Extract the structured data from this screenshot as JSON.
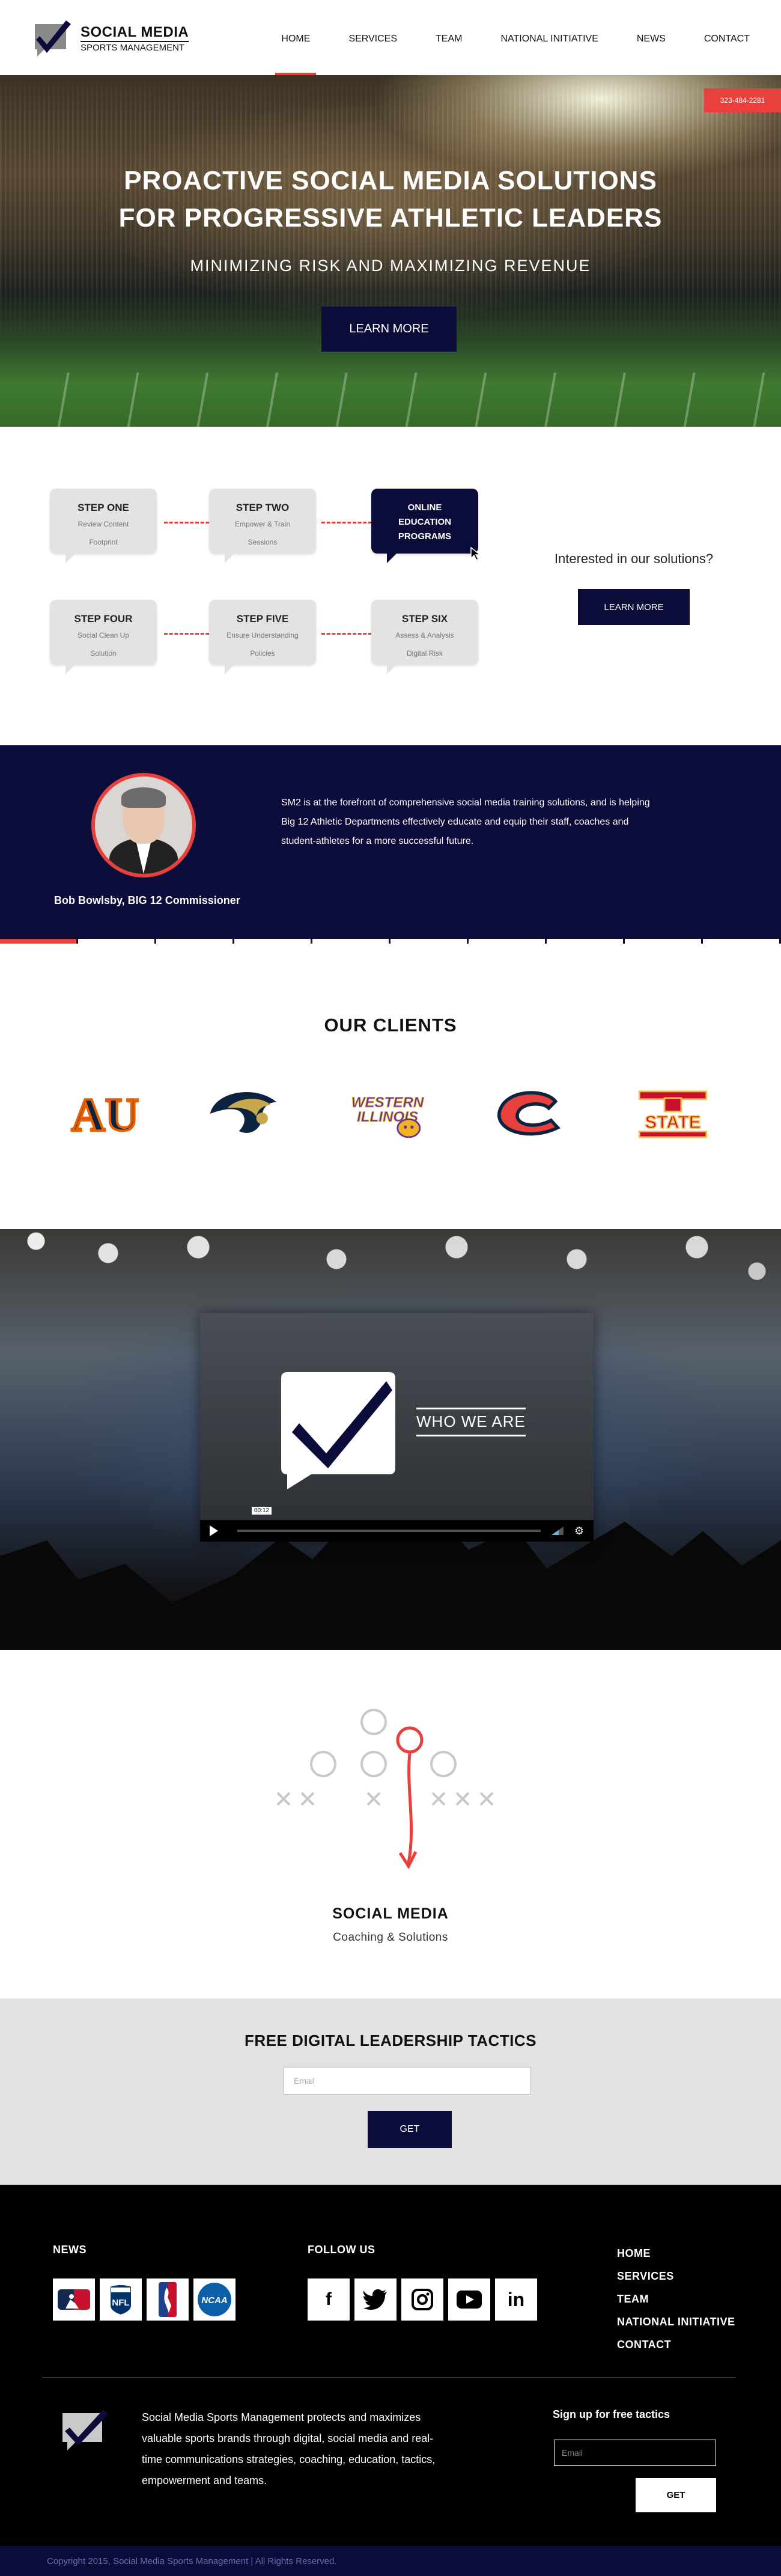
{
  "header": {
    "logo_line1": "SOCIAL MEDIA",
    "logo_line2": "SPORTS MANAGEMENT",
    "nav": [
      {
        "label": "HOME",
        "active": true
      },
      {
        "label": "SERVICES"
      },
      {
        "label": "TEAM"
      },
      {
        "label": "NATIONAL INITIATIVE"
      },
      {
        "label": "NEWS"
      },
      {
        "label": "CONTACT"
      }
    ]
  },
  "hero": {
    "phone": "323-484-2281",
    "title_line1": "PROACTIVE SOCIAL MEDIA SOLUTIONS",
    "title_line2": "FOR PROGRESSIVE ATHLETIC LEADERS",
    "subtitle": "MINIMIZING RISK AND MAXIMIZING REVENUE",
    "cta": "LEARN MORE"
  },
  "steps": {
    "items": [
      {
        "title": "STEP ONE",
        "desc_line1": "Review Content",
        "desc_line2": "Footprint"
      },
      {
        "title": "STEP TWO",
        "desc_line1": "Empower & Train",
        "desc_line2": "Sessions"
      },
      {
        "title_line1": "ONLINE",
        "title_line2": "EDUCATION",
        "title_line3": "PROGRAMS",
        "active": true
      },
      {
        "title": "STEP FOUR",
        "desc_line1": "Social Clean Up",
        "desc_line2": "Solution"
      },
      {
        "title": "STEP FIVE",
        "desc_line1": "Ensure Understanding",
        "desc_line2": "Policies"
      },
      {
        "title": "STEP SIX",
        "desc_line1": "Assess & Analysis",
        "desc_line2": "Digital Risk"
      }
    ],
    "interest": "Interested in our solutions?",
    "cta": "LEARN MORE"
  },
  "testimonial": {
    "name": "Bob Bowlsby, BIG 12 Commissioner",
    "quote": "SM2 is at the forefront of comprehensive social media training solutions, and is helping Big 12 Athletic Departments effectively educate and equip their staff, coaches and student-athletes for a more successful future.",
    "slides_total": 10,
    "slide_active": 1
  },
  "clients": {
    "heading": "OUR CLIENTS",
    "logos": [
      {
        "icon": "auburn-au-logo",
        "text": "AU"
      },
      {
        "icon": "rams-horn-logo"
      },
      {
        "icon": "western-illinois-logo",
        "text_line1": "WESTERN",
        "text_line2": "ILLINOIS"
      },
      {
        "icon": "chicago-bears-c-logo"
      },
      {
        "icon": "iowa-state-logo",
        "text": "STATE"
      }
    ]
  },
  "video": {
    "overlay": "WHO WE ARE",
    "tooltip": "00:12"
  },
  "social": {
    "heading": "SOCIAL MEDIA",
    "sub": "Coaching & Solutions"
  },
  "tactics": {
    "heading": "FREE DIGITAL LEADERSHIP TACTICS",
    "email_placeholder": "Email",
    "cta": "GET"
  },
  "footer": {
    "news_heading": "NEWS",
    "news_logos": [
      "mlb-logo",
      "nfl-logo",
      "nba-logo",
      "ncaa-logo"
    ],
    "follow_heading": "FOLLOW US",
    "social_icons": [
      {
        "icon": "facebook-icon",
        "glyph": "f"
      },
      {
        "icon": "twitter-icon"
      },
      {
        "icon": "instagram-icon"
      },
      {
        "icon": "youtube-icon"
      },
      {
        "icon": "linkedin-icon",
        "glyph": "in"
      }
    ],
    "nav": [
      "HOME",
      "SERVICES",
      "TEAM",
      "NATIONAL INITIATIVE",
      "CONTACT"
    ],
    "blurb": "Social Media Sports Management protects and maximizes valuable sports brands through digital, social media and real-time communications strategies, coaching, education, tactics, empowerment and teams.",
    "signup_heading": "Sign up for free tactics",
    "email_placeholder": "Email",
    "cta": "GET",
    "copyright": "Copyright 2015, Social Media Sports Management | All Rights Reserved."
  },
  "colors": {
    "navy": "#0c0c3a",
    "accent_red": "#e8413d",
    "light_gray": "#e2e2e2"
  }
}
